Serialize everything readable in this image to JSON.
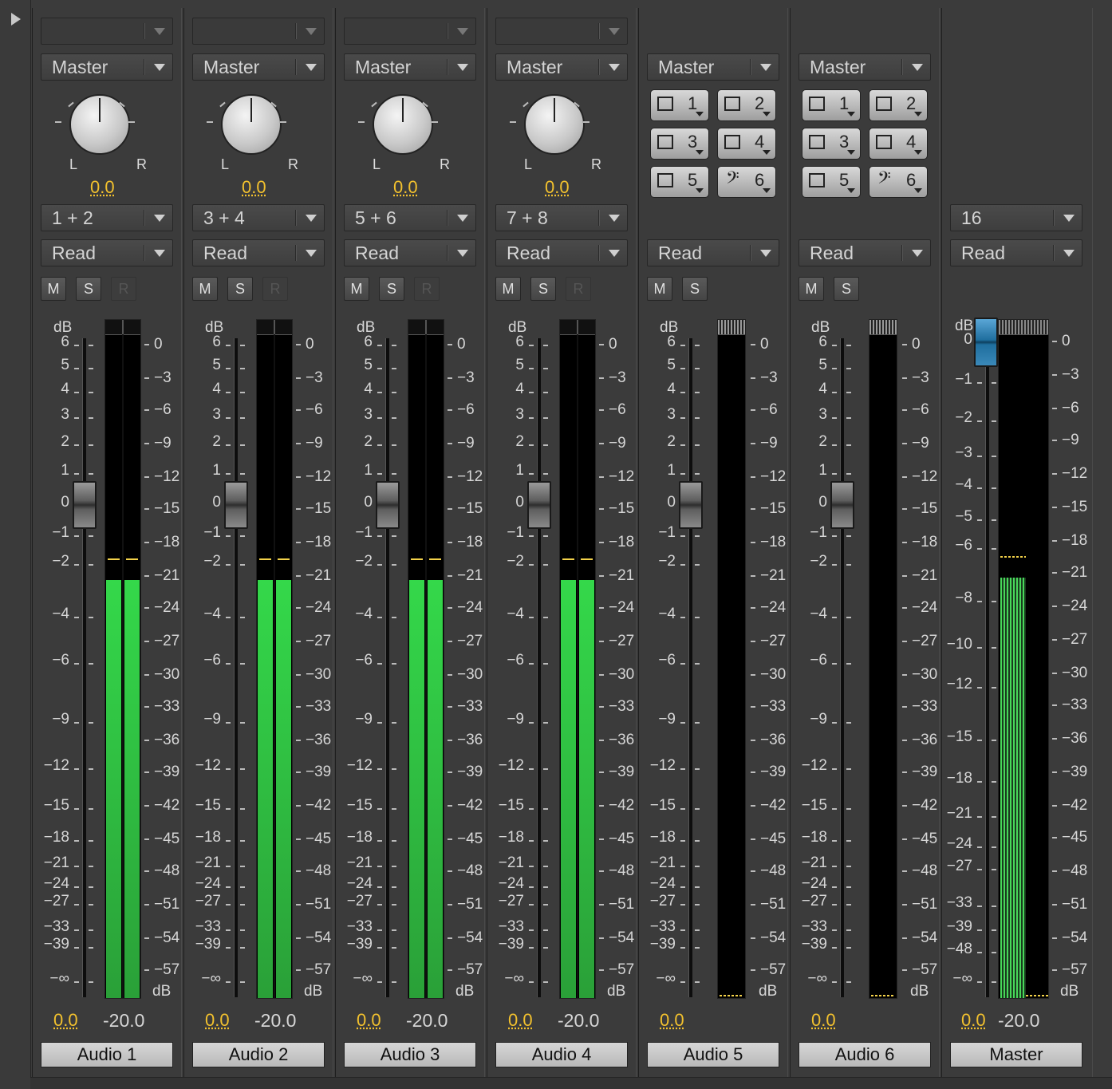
{
  "strips": [
    {
      "name": "Audio 1",
      "top_select": "",
      "output": "Master",
      "pan": "0.0",
      "pan_left": "L",
      "pan_right": "R",
      "routing": "1 + 2",
      "automation": "Read",
      "mute": "M",
      "solo": "S",
      "record": "R",
      "volume": "0.0",
      "meter_readout": "-20.0",
      "meter_level": -22.0,
      "peak": -20.0,
      "kind": "stereo"
    },
    {
      "name": "Audio 2",
      "top_select": "",
      "output": "Master",
      "pan": "0.0",
      "pan_left": "L",
      "pan_right": "R",
      "routing": "3 + 4",
      "automation": "Read",
      "mute": "M",
      "solo": "S",
      "record": "R",
      "volume": "0.0",
      "meter_readout": "-20.0",
      "meter_level": -22.0,
      "peak": -20.0,
      "kind": "stereo"
    },
    {
      "name": "Audio 3",
      "top_select": "",
      "output": "Master",
      "pan": "0.0",
      "pan_left": "L",
      "pan_right": "R",
      "routing": "5 + 6",
      "automation": "Read",
      "mute": "M",
      "solo": "S",
      "record": "R",
      "volume": "0.0",
      "meter_readout": "-20.0",
      "meter_level": -22.0,
      "peak": -20.0,
      "kind": "stereo"
    },
    {
      "name": "Audio 4",
      "top_select": "",
      "output": "Master",
      "pan": "0.0",
      "pan_left": "L",
      "pan_right": "R",
      "routing": "7 + 8",
      "automation": "Read",
      "mute": "M",
      "solo": "S",
      "record": "R",
      "volume": "0.0",
      "meter_readout": "-20.0",
      "meter_level": -22.0,
      "peak": -20.0,
      "kind": "stereo"
    },
    {
      "name": "Audio 5",
      "output": "Master",
      "speakers": [
        "1",
        "2",
        "3",
        "4",
        "5",
        "6"
      ],
      "automation": "Read",
      "mute": "M",
      "solo": "S",
      "volume": "0.0",
      "kind": "surround"
    },
    {
      "name": "Audio 6",
      "output": "Master",
      "speakers": [
        "1",
        "2",
        "3",
        "4",
        "5",
        "6"
      ],
      "automation": "Read",
      "mute": "M",
      "solo": "S",
      "volume": "0.0",
      "kind": "surround"
    }
  ],
  "master": {
    "name": "Master",
    "channels": "16",
    "automation": "Read",
    "volume": "0.0",
    "meter_readout": "-20.0",
    "meter_level": -22.0,
    "peak": -20.0
  },
  "fader_scale": [
    "6",
    "5",
    "4",
    "3",
    "2",
    "1",
    "0",
    "−1",
    "−2",
    "−4",
    "−6",
    "−9",
    "−12",
    "−15",
    "−18",
    "−21",
    "−24",
    "−27",
    "−33",
    "−39",
    "−∞"
  ],
  "fader_scale_title": "dB",
  "meter_scale": [
    "0",
    "−3",
    "−6",
    "−9",
    "−12",
    "−15",
    "−18",
    "−21",
    "−24",
    "−27",
    "−30",
    "−33",
    "−36",
    "−39",
    "−42",
    "−45",
    "−48",
    "−51",
    "−54",
    "−57"
  ],
  "meter_scale_unit": "dB",
  "master_fader_scale": [
    "0",
    "−1",
    "−2",
    "−3",
    "−4",
    "−5",
    "−6",
    "−8",
    "−10",
    "−12",
    "−15",
    "−18",
    "−21",
    "−24",
    "−27",
    "−33",
    "−39",
    "−48",
    "−∞"
  ]
}
